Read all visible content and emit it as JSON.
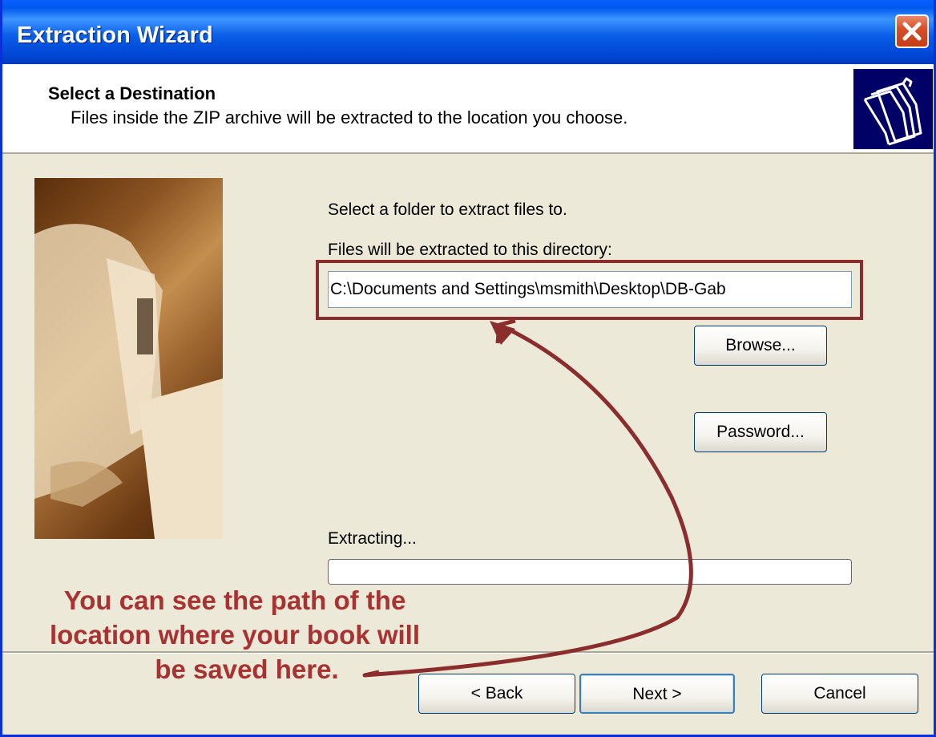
{
  "window": {
    "title": "Extraction Wizard",
    "close_label": "Close"
  },
  "header": {
    "title": "Select a Destination",
    "subtitle": "Files inside the ZIP archive will be extracted to the location you choose."
  },
  "main": {
    "instruction": "Select a folder to extract files to.",
    "directory_label": "Files will be extracted to this directory:",
    "directory_value": "C:\\Documents and Settings\\msmith\\Desktop\\DB-Gab",
    "browse_label": "Browse...",
    "password_label": "Password...",
    "progress_label": "Extracting...",
    "progress_value": 0
  },
  "annotation": {
    "line1": "You can see the path of the",
    "line2": "location where your book will",
    "line3": "be saved here.",
    "color": "#a83232"
  },
  "footer": {
    "back_label": "< Back",
    "next_label": "Next >",
    "cancel_label": "Cancel"
  },
  "icons": {
    "header_icon": "folders-icon",
    "close_icon": "close-icon"
  }
}
